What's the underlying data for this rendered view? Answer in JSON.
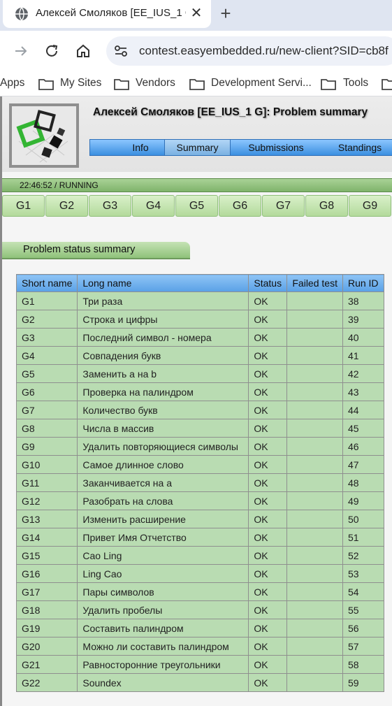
{
  "browser": {
    "tab_title": "Алексей Смоляков [EE_IUS_1 G",
    "url": "contest.easyembedded.ru/new-client?SID=cb8f",
    "bookmarks": [
      "Apps",
      "My Sites",
      "Vendors",
      "Development Servi...",
      "Tools"
    ]
  },
  "header": {
    "title": "Алексей Смоляков [EE_IUS_1 G]: Problem summary",
    "menu": [
      "Info",
      "Summary",
      "Submissions",
      "Standings"
    ],
    "active_menu": "Summary"
  },
  "status": {
    "time": "22:46:52",
    "separator": " / ",
    "state": "RUNNING"
  },
  "problem_tabs": [
    "G1",
    "G2",
    "G3",
    "G4",
    "G5",
    "G6",
    "G7",
    "G8",
    "G9"
  ],
  "section": {
    "title": "Problem status summary"
  },
  "table": {
    "headers": [
      "Short name",
      "Long name",
      "Status",
      "Failed test",
      "Run ID"
    ],
    "rows": [
      [
        "G1",
        "Три раза",
        "OK",
        "",
        "38"
      ],
      [
        "G2",
        "Строка и цифры",
        "OK",
        "",
        "39"
      ],
      [
        "G3",
        "Последний символ - номера",
        "OK",
        "",
        "40"
      ],
      [
        "G4",
        "Совпадения букв",
        "OK",
        "",
        "41"
      ],
      [
        "G5",
        "Заменить a на b",
        "OK",
        "",
        "42"
      ],
      [
        "G6",
        "Проверка на палиндром",
        "OK",
        "",
        "43"
      ],
      [
        "G7",
        "Количество букв",
        "OK",
        "",
        "44"
      ],
      [
        "G8",
        "Числа в массив",
        "OK",
        "",
        "45"
      ],
      [
        "G9",
        "Удалить повторяющиеся символы",
        "OK",
        "",
        "46"
      ],
      [
        "G10",
        "Самое длинное слово",
        "OK",
        "",
        "47"
      ],
      [
        "G11",
        "Заканчивается на a",
        "OK",
        "",
        "48"
      ],
      [
        "G12",
        "Разобрать на слова",
        "OK",
        "",
        "49"
      ],
      [
        "G13",
        "Изменить расширение",
        "OK",
        "",
        "50"
      ],
      [
        "G14",
        "Привет Имя Отчетство",
        "OK",
        "",
        "51"
      ],
      [
        "G15",
        "Cao Ling",
        "OK",
        "",
        "52"
      ],
      [
        "G16",
        "Ling Cao",
        "OK",
        "",
        "53"
      ],
      [
        "G17",
        "Пары символов",
        "OK",
        "",
        "54"
      ],
      [
        "G18",
        "Удалить пробелы",
        "OK",
        "",
        "55"
      ],
      [
        "G19",
        "Составить палиндром",
        "OK",
        "",
        "56"
      ],
      [
        "G20",
        "Можно ли составить палиндром",
        "OK",
        "",
        "57"
      ],
      [
        "G21",
        "Равносторонние треугольники",
        "OK",
        "",
        "58"
      ],
      [
        "G22",
        "Soundex",
        "OK",
        "",
        "59"
      ]
    ]
  }
}
